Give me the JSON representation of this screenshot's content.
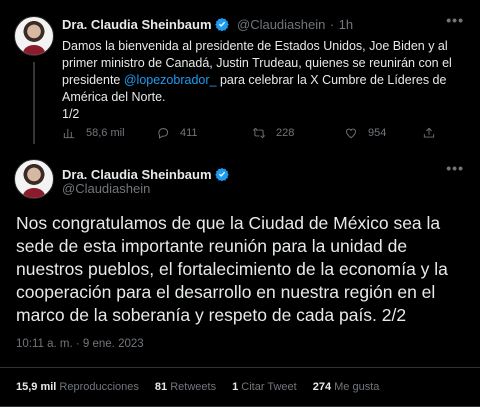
{
  "tweet1": {
    "author_name": "Dra. Claudia Sheinbaum",
    "handle": "@Claudiashein",
    "separator": "·",
    "time": "1h",
    "text_part1": "Damos la bienvenida al presidente de Estados Unidos, Joe Biden y al primer ministro de Canadá, Justin Trudeau, quienes se reunirán con el presidente ",
    "mention": "@lopezobrador_",
    "text_part2": " para celebrar la X Cumbre de Líderes de América del Norte.",
    "thread_count": "1/2",
    "views": "58,6 mil",
    "replies": "411",
    "retweets": "228",
    "likes": "954"
  },
  "tweet2": {
    "author_name": "Dra. Claudia Sheinbaum",
    "handle": "@Claudiashein",
    "text": "Nos congratulamos de que la Ciudad de México sea la sede de esta importante reunión para la unidad de nuestros pueblos, el fortalecimiento de la economía y la cooperación para el desarrollo en nuestra región en el marco de la soberanía y respeto de cada país. 2/2",
    "timestamp": "10:11 a. m. · 9 ene. 2023",
    "stats": [
      {
        "value": "15,9 mil",
        "label": "Reproducciones"
      },
      {
        "value": "81",
        "label": "Retweets"
      },
      {
        "value": "1",
        "label": "Citar Tweet"
      },
      {
        "value": "274",
        "label": "Me gusta"
      }
    ]
  },
  "colors": {
    "background": "#000000",
    "text": "#e7e9ea",
    "secondary": "#71767b",
    "accent": "#1d9bf0",
    "divider": "#2f3336"
  }
}
